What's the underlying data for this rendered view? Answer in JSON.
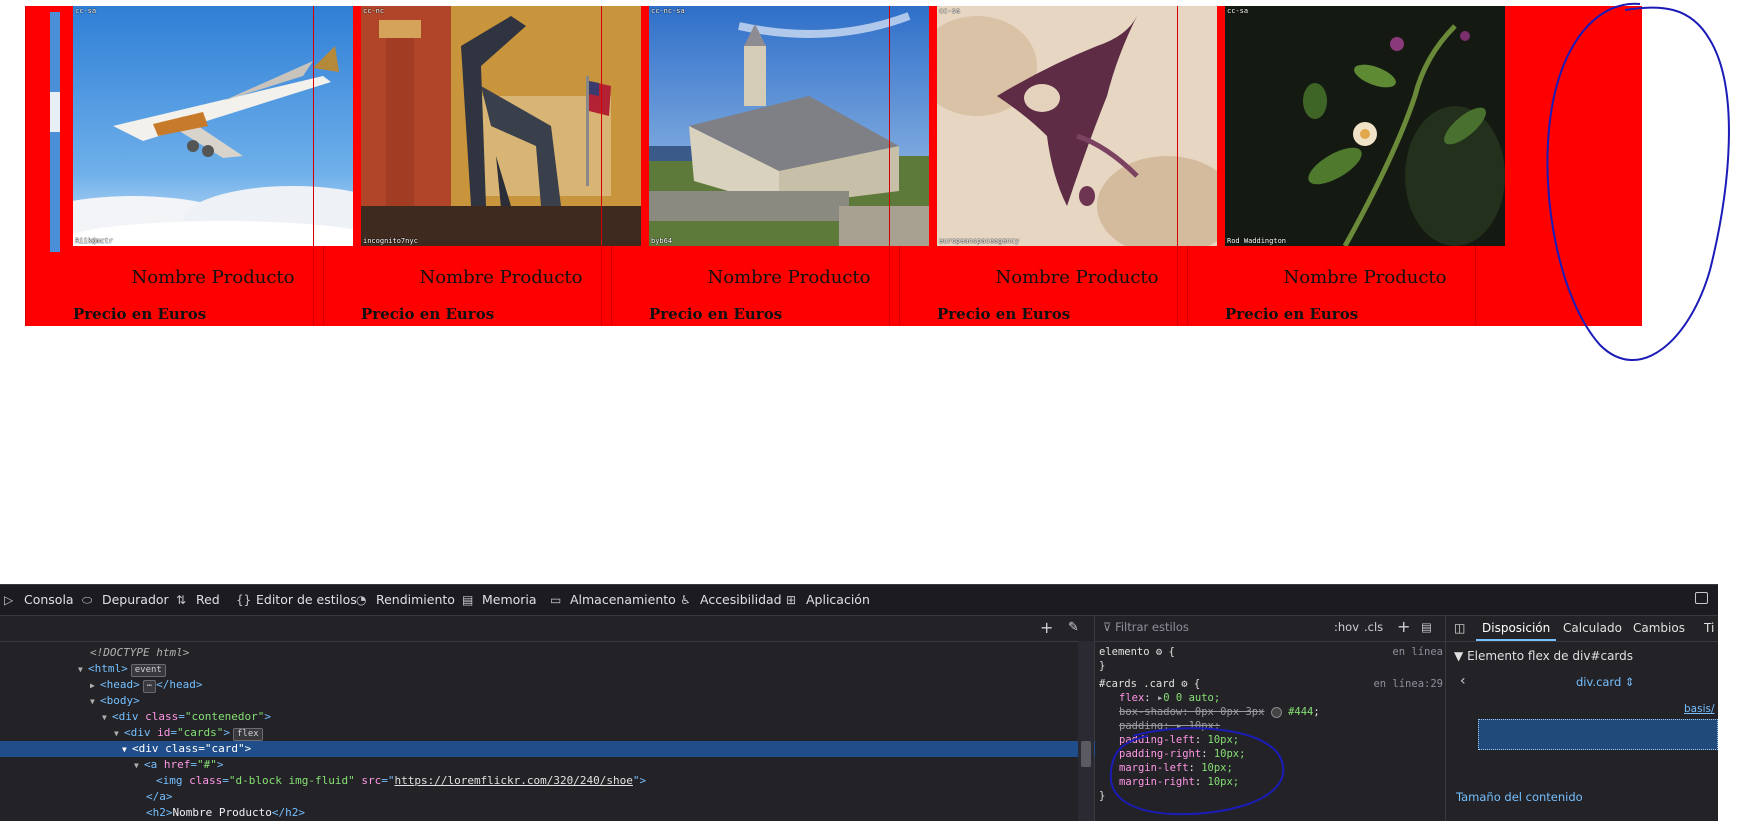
{
  "page": {
    "edge_card_image": "airplane-sliver",
    "cards": [
      {
        "image": "airplane",
        "license_top": "cc-sa",
        "credit": "Riik@mctr",
        "name": "Nombre Producto",
        "price": "Precio en Euros"
      },
      {
        "image": "dinosaur-museum",
        "license_top": "cc-nc",
        "credit": "incognito7nyc",
        "name": "Nombre Producto",
        "price": "Precio en Euros"
      },
      {
        "image": "stone-chapel",
        "license_top": "cc-nc-sa",
        "credit": "byb64",
        "name": "Nombre Producto",
        "price": "Precio en Euros"
      },
      {
        "image": "abstract-sediment",
        "license_top": "cc-sa",
        "credit": "europeanspaceagency",
        "name": "Nombre Producto",
        "price": "Precio en Euros"
      },
      {
        "image": "flower-branch",
        "license_top": "cc-sa",
        "credit": "Rod Waddington",
        "name": "Nombre Producto",
        "price": "Precio en Euros"
      }
    ],
    "card_background": "#ff0000"
  },
  "devtools": {
    "tabs": [
      {
        "icon": "console-icon",
        "glyph": "▷",
        "label": "Consola"
      },
      {
        "icon": "debugger-icon",
        "glyph": "⬭",
        "label": "Depurador"
      },
      {
        "icon": "network-icon",
        "glyph": "⇅",
        "label": "Red"
      },
      {
        "icon": "style-editor-icon",
        "glyph": "{}",
        "label": "Editor de estilos"
      },
      {
        "icon": "performance-icon",
        "glyph": "◔",
        "label": "Rendimiento"
      },
      {
        "icon": "memory-icon",
        "glyph": "▤",
        "label": "Memoria"
      },
      {
        "icon": "storage-icon",
        "glyph": "▭",
        "label": "Almacenamiento"
      },
      {
        "icon": "accessibility-icon",
        "glyph": "♿",
        "label": "Accesibilidad"
      },
      {
        "icon": "application-icon",
        "glyph": "⊞",
        "label": "Aplicación"
      }
    ],
    "markup": {
      "doctype": "<!DOCTYPE html>",
      "html_tag": "html",
      "event_badge": "event",
      "head_tag": "head",
      "head_close": "</head>",
      "ellipsis_badge": "⋯",
      "body_tag": "body",
      "contenedor_attr": "class",
      "contenedor_val": "\"contenedor\"",
      "cards_attr": "id",
      "cards_val": "\"cards\"",
      "flex_badge": "flex",
      "card_attr": "class",
      "card_val": "\"card\"",
      "a_attr": "href",
      "a_val": "\"#\"",
      "img_attr_class": "class",
      "img_class_val": "\"d-block img-fluid\"",
      "img_attr_src": "src",
      "img_src_val": "https://loremflickr.com/320/240/shoe",
      "a_close": "</a>",
      "h2_text": "Nombre Producto"
    },
    "rules": {
      "filter_placeholder": "Filtrar estilos",
      "hov": ":hov",
      "cls": ".cls",
      "element_selector": "elemento",
      "element_source": "en línea",
      "card_selector": "#cards .card",
      "card_source": "en línea:29",
      "declarations": [
        {
          "prop": "flex",
          "value": "0 0 auto;",
          "struck": false
        },
        {
          "prop": "box-shadow",
          "value": "0px 0px 3px",
          "color": "#444",
          "struck": true
        },
        {
          "prop": "padding",
          "value": "10px;",
          "struck": true
        },
        {
          "prop": "padding-left",
          "value": "10px;",
          "struck": false
        },
        {
          "prop": "padding-right",
          "value": "10px;",
          "struck": false
        },
        {
          "prop": "margin-left",
          "value": "10px;",
          "struck": false
        },
        {
          "prop": "margin-right",
          "value": "10px;",
          "struck": false
        }
      ]
    },
    "layout": {
      "tabs": [
        "Disposición",
        "Calculado",
        "Cambios",
        "Ti"
      ],
      "active_tab": "Disposición",
      "heading": "Elemento flex de div#cards",
      "selector": "div.card",
      "basis": "basis/",
      "size_label": "Tamaño del contenido"
    }
  }
}
